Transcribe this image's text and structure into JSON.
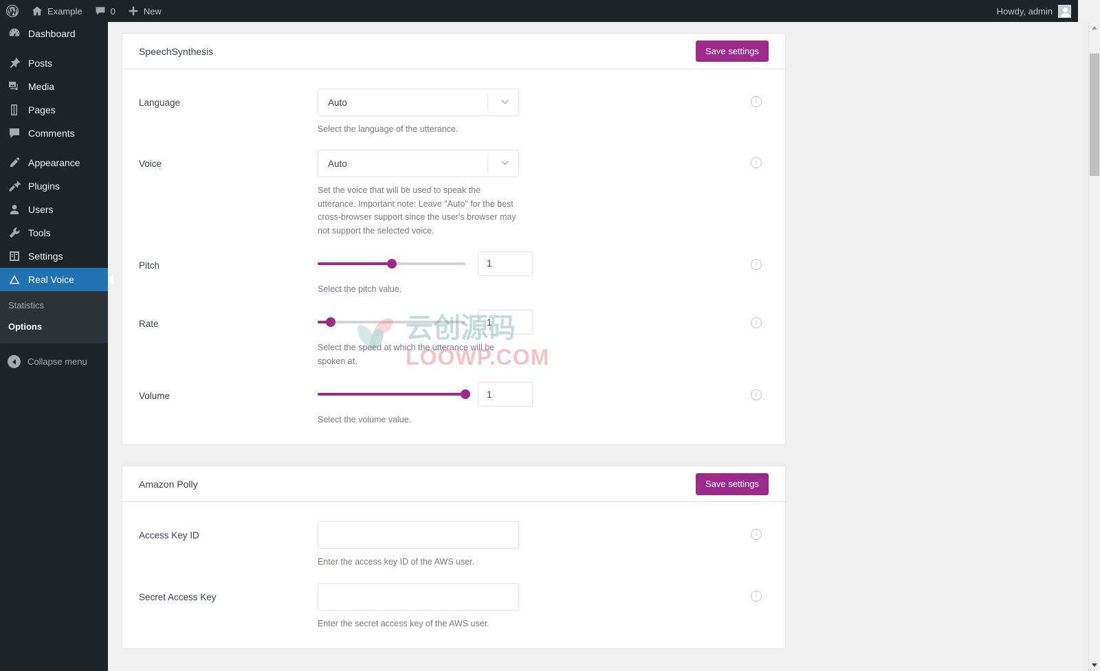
{
  "adminbar": {
    "wp_logo": "wordpress-logo-icon",
    "site_name": "Example",
    "comments_count": "0",
    "new_label": "New",
    "howdy": "Howdy, admin"
  },
  "sidebar": {
    "items": [
      {
        "label": "Dashboard",
        "icon": "dashboard-icon",
        "current": false
      },
      {
        "label": "Posts",
        "icon": "pin-icon",
        "current": false
      },
      {
        "label": "Media",
        "icon": "media-icon",
        "current": false
      },
      {
        "label": "Pages",
        "icon": "page-icon",
        "current": false
      },
      {
        "label": "Comments",
        "icon": "comment-icon",
        "current": false
      },
      {
        "label": "Appearance",
        "icon": "brush-icon",
        "current": false
      },
      {
        "label": "Plugins",
        "icon": "plug-icon",
        "current": false
      },
      {
        "label": "Users",
        "icon": "user-icon",
        "current": false
      },
      {
        "label": "Tools",
        "icon": "wrench-icon",
        "current": false
      },
      {
        "label": "Settings",
        "icon": "settings-icon",
        "current": false
      },
      {
        "label": "Real Voice",
        "icon": "real-voice-icon",
        "current": true
      }
    ],
    "submenu": [
      {
        "label": "Statistics",
        "current": false
      },
      {
        "label": "Options",
        "current": true
      }
    ],
    "collapse_label": "Collapse menu",
    "highlight_color": "#2271b1"
  },
  "accent_color": "#9b2a8a",
  "cards": [
    {
      "title": "SpeechSynthesis",
      "save_label": "Save settings",
      "fields": [
        {
          "label": "Language",
          "type": "select",
          "value": "Auto",
          "desc": "Select the language of the utterance.",
          "info": "info-icon"
        },
        {
          "label": "Voice",
          "type": "select",
          "value": "Auto",
          "desc": "Set the voice that will be used to speak the utterance. Important note: Leave \"Auto\" for the best cross-browser support since the user's browser may not support the selected voice.",
          "info": "info-icon"
        },
        {
          "label": "Pitch",
          "type": "slider",
          "value": "1",
          "percent": 50,
          "desc": "Select the pitch value.",
          "info": "info-icon"
        },
        {
          "label": "Rate",
          "type": "slider",
          "value": "1",
          "percent": 9,
          "desc": "Select the speed at which the utterance will be spoken at.",
          "info": "info-icon"
        },
        {
          "label": "Volume",
          "type": "slider",
          "value": "1",
          "percent": 100,
          "desc": "Select the volume value.",
          "info": "info-icon"
        }
      ]
    },
    {
      "title": "Amazon Polly",
      "save_label": "Save settings",
      "fields": [
        {
          "label": "Access Key ID",
          "type": "text",
          "value": "",
          "placeholder": "",
          "desc": "Enter the access key ID of the AWS user.",
          "info": "info-icon"
        },
        {
          "label": "Secret Access Key",
          "type": "text",
          "value": "",
          "placeholder": "",
          "desc": "Enter the secret access key of the AWS user.",
          "info": "info-icon"
        }
      ]
    }
  ],
  "watermark": {
    "cn_text": "云创源码",
    "url_text": "LOOWP.COM"
  }
}
